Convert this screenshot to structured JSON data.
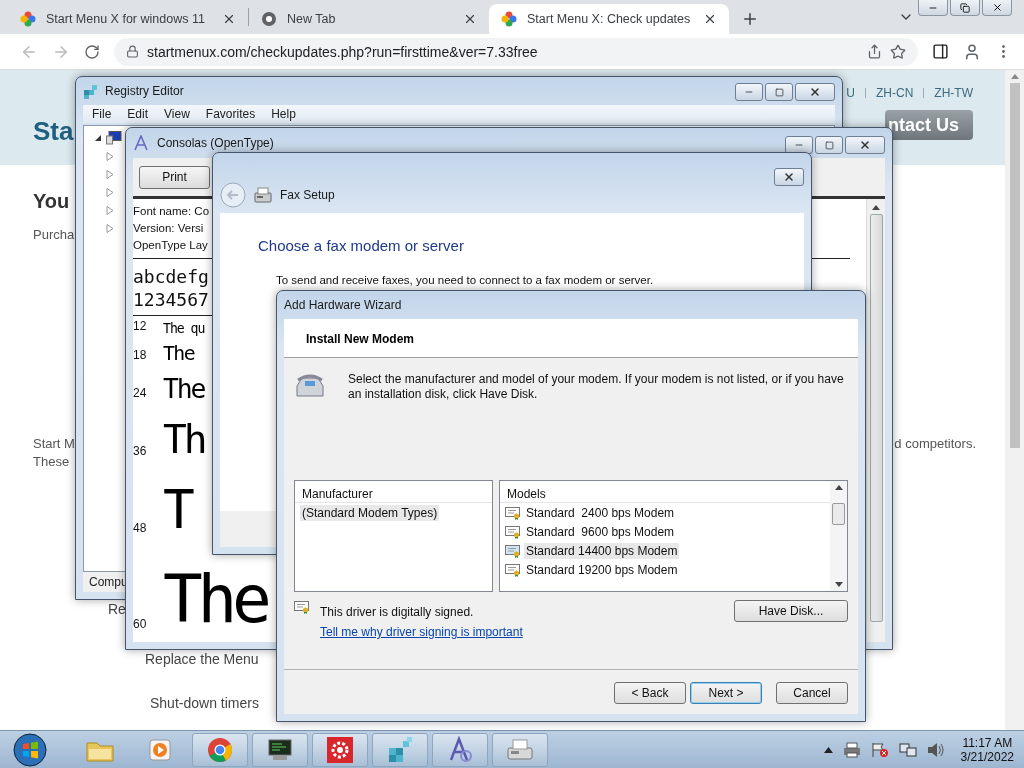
{
  "browser": {
    "tabs": [
      {
        "title": "Start Menu X for windows 11",
        "selected": false
      },
      {
        "title": "New Tab",
        "selected": false
      },
      {
        "title": "Start Menu X: Check updates",
        "selected": true
      }
    ],
    "url": "startmenux.com/checkupdates.php?run=firsttime&ver=7.33free"
  },
  "page": {
    "logo": "Sta",
    "languages": [
      "U",
      "ZH-CN",
      "ZH-TW"
    ],
    "contact_button": "ntact Us",
    "heading": "You",
    "intro": "Purcha",
    "paragraph_line_1_left": "Start M",
    "paragraph_line_1_right": "d competitors.",
    "paragraph_line_2_left": "These",
    "links": [
      "Re",
      "Replace the Menu",
      "Shut-down timers"
    ]
  },
  "registry_editor": {
    "title": "Registry Editor",
    "menu": [
      "File",
      "Edit",
      "View",
      "Favorites",
      "Help"
    ],
    "tree": {
      "expanded": true,
      "children": [
        {
          "expanded": false
        },
        {
          "expanded": false
        },
        {
          "expanded": false
        },
        {
          "expanded": false
        },
        {
          "expanded": false
        }
      ]
    },
    "status_bar": "Compu"
  },
  "font_viewer": {
    "title": "Consolas (OpenType)",
    "print_button": "Print",
    "info": [
      "Font name: Co",
      "Version: Versi",
      "OpenType Lay"
    ],
    "alphabet": "abcdefg",
    "digits": "1234567",
    "samples": [
      {
        "size": "12",
        "text": "The qu"
      },
      {
        "size": "18",
        "text": "The"
      },
      {
        "size": "24",
        "text": "The"
      },
      {
        "size": "36",
        "text": "Th"
      },
      {
        "size": "48",
        "text": "T"
      },
      {
        "size": "60",
        "text": "The"
      }
    ]
  },
  "fax_setup": {
    "title": "Fax Setup",
    "heading": "Choose a fax modem or server",
    "description": "To send and receive faxes, you need to connect to a fax modem or server."
  },
  "wizard": {
    "title": "Add Hardware Wizard",
    "header": "Install New Modem",
    "instructions": "Select the manufacturer and model of your modem. If your modem is not listed, or if you have an installation disk, click Have Disk.",
    "manufacturers": {
      "heading": "Manufacturer",
      "items": [
        {
          "label": "(Standard Modem Types)",
          "selected": true
        }
      ]
    },
    "models": {
      "heading": "Models",
      "items": [
        {
          "label": "Standard  2400 bps Modem",
          "selected": false
        },
        {
          "label": "Standard  9600 bps Modem",
          "selected": false
        },
        {
          "label": "Standard 14400 bps Modem",
          "selected": true
        },
        {
          "label": "Standard 19200 bps Modem",
          "selected": false
        }
      ]
    },
    "signed_note": "This driver is digitally signed.",
    "signing_link": "Tell me why driver signing is important",
    "have_disk_button": "Have Disk...",
    "buttons": [
      {
        "label": "< Back",
        "default": false
      },
      {
        "label": "Next >",
        "default": true
      },
      {
        "label": "Cancel",
        "default": false
      }
    ]
  },
  "taskbar": {
    "time": "11:17 AM",
    "date": "3/21/2022"
  }
}
